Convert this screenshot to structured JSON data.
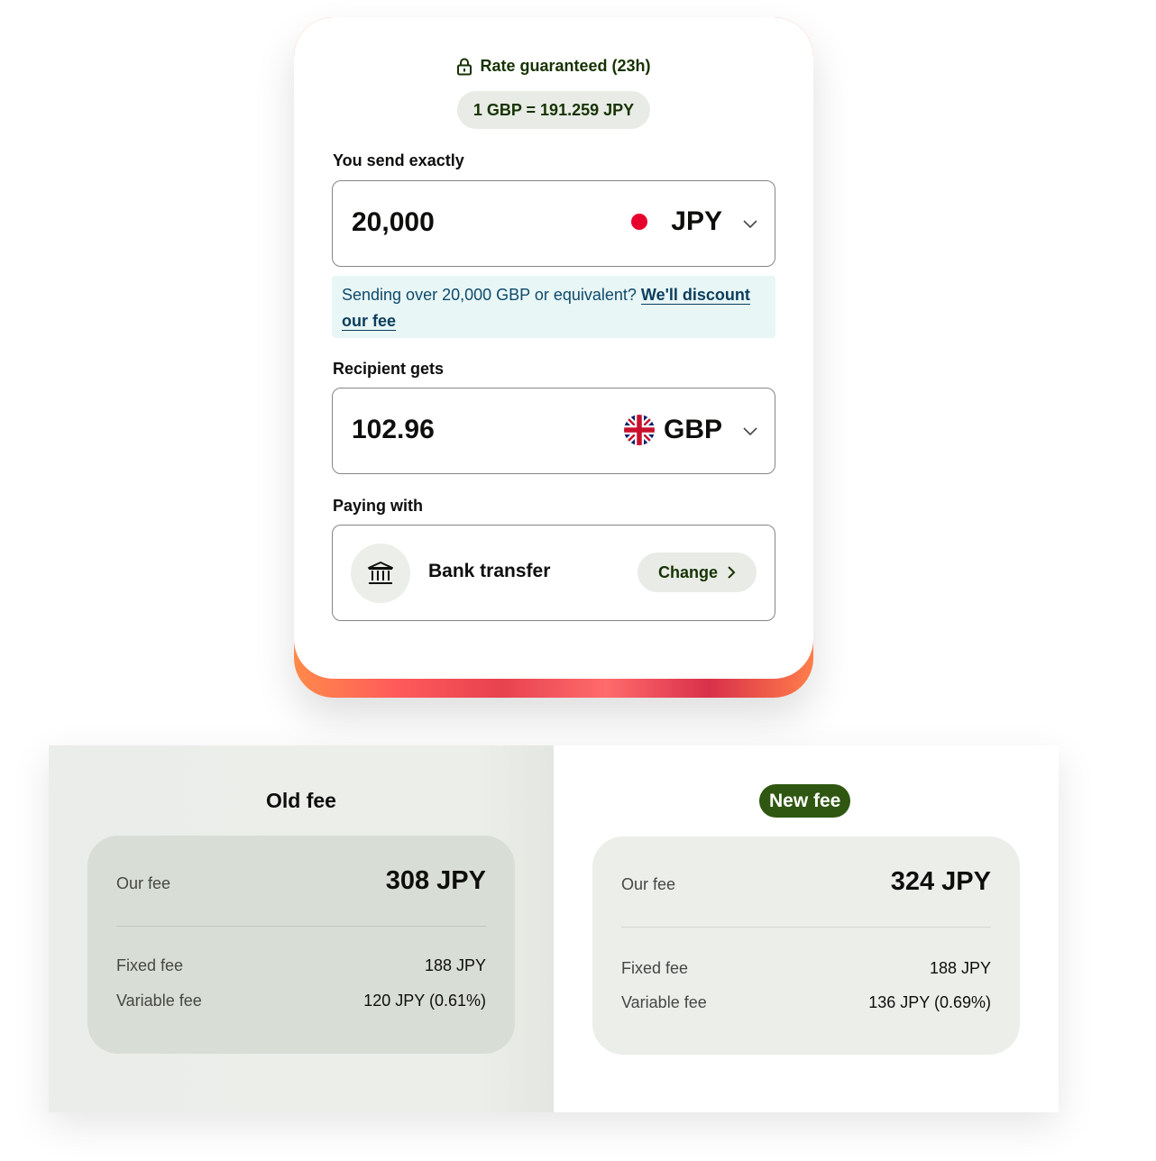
{
  "calculator": {
    "rate_guarantee": "Rate guaranteed (23h)",
    "rate": "1 GBP = 191.259 JPY",
    "send_label": "You send exactly",
    "send_amount": "20,000",
    "send_currency": "JPY",
    "notice_text": "Sending over 20,000 GBP or equivalent? ",
    "notice_link": "We'll discount our fee",
    "receive_label": "Recipient gets",
    "receive_amount": "102.96",
    "receive_currency": "GBP",
    "paying_label": "Paying with",
    "payment_method": "Bank transfer",
    "change_label": "Change"
  },
  "fees": {
    "old": {
      "title": "Old fee",
      "our_fee_label": "Our fee",
      "our_fee_value": "308 JPY",
      "fixed_label": "Fixed fee",
      "fixed_value": "188 JPY",
      "variable_label": "Variable fee",
      "variable_value": "120 JPY (0.61%)"
    },
    "new": {
      "title": "New fee",
      "our_fee_label": "Our fee",
      "our_fee_value": "324 JPY",
      "fixed_label": "Fixed fee",
      "fixed_value": "188 JPY",
      "variable_label": "Variable fee",
      "variable_value": "136 JPY (0.69%)"
    }
  },
  "colors": {
    "brand_dark_green": "#163300",
    "new_badge_bg": "#2f5711",
    "jpy_flag_red": "#e8002c",
    "notice_bg": "#e8f6f6"
  },
  "icons": [
    "lock-icon",
    "chevron-down-icon",
    "japan-flag-icon",
    "uk-flag-icon",
    "bank-icon",
    "chevron-right-icon"
  ]
}
